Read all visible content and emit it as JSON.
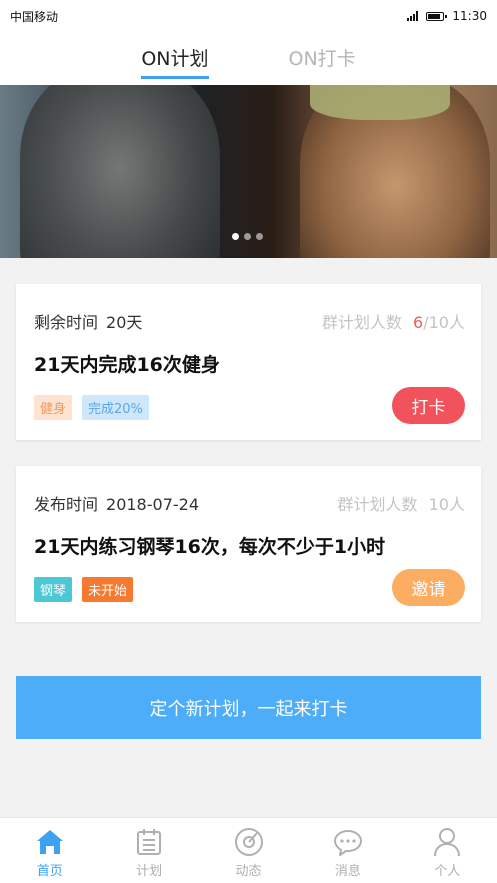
{
  "statusbar": {
    "carrier": "中国移动",
    "time": "11:30"
  },
  "tabs": [
    {
      "label": "ON计划",
      "active": true
    },
    {
      "label": "ON打卡",
      "active": false
    }
  ],
  "banner": {
    "slide_count": 3,
    "active_slide": 1
  },
  "plans": [
    {
      "meta_label": "剩余时间",
      "meta_value": "20天",
      "count_label": "群计划人数",
      "count_current": "6",
      "count_total": "/10人",
      "title": "21天内完成16次健身",
      "tags": [
        "健身",
        "完成20%"
      ],
      "button": "打卡"
    },
    {
      "meta_label": "发布时间",
      "meta_value": "2018-07-24",
      "count_label": "群计划人数",
      "count_total": "10人",
      "title": "21天内练习钢琴16次，每次不少于1小时",
      "tags": [
        "钢琴",
        "未开始"
      ],
      "button": "邀请"
    }
  ],
  "new_plan_button": "定个新计划，一起来打卡",
  "nav": [
    {
      "label": "首页",
      "icon": "home-icon",
      "active": true
    },
    {
      "label": "计划",
      "icon": "plan-icon",
      "active": false
    },
    {
      "label": "动态",
      "icon": "activity-icon",
      "active": false
    },
    {
      "label": "消息",
      "icon": "message-icon",
      "active": false
    },
    {
      "label": "个人",
      "icon": "profile-icon",
      "active": false
    }
  ],
  "colors": {
    "accent": "#3ea2f1",
    "red": "#f2525b",
    "orange": "#fbad62",
    "cta": "#4dadf8"
  }
}
